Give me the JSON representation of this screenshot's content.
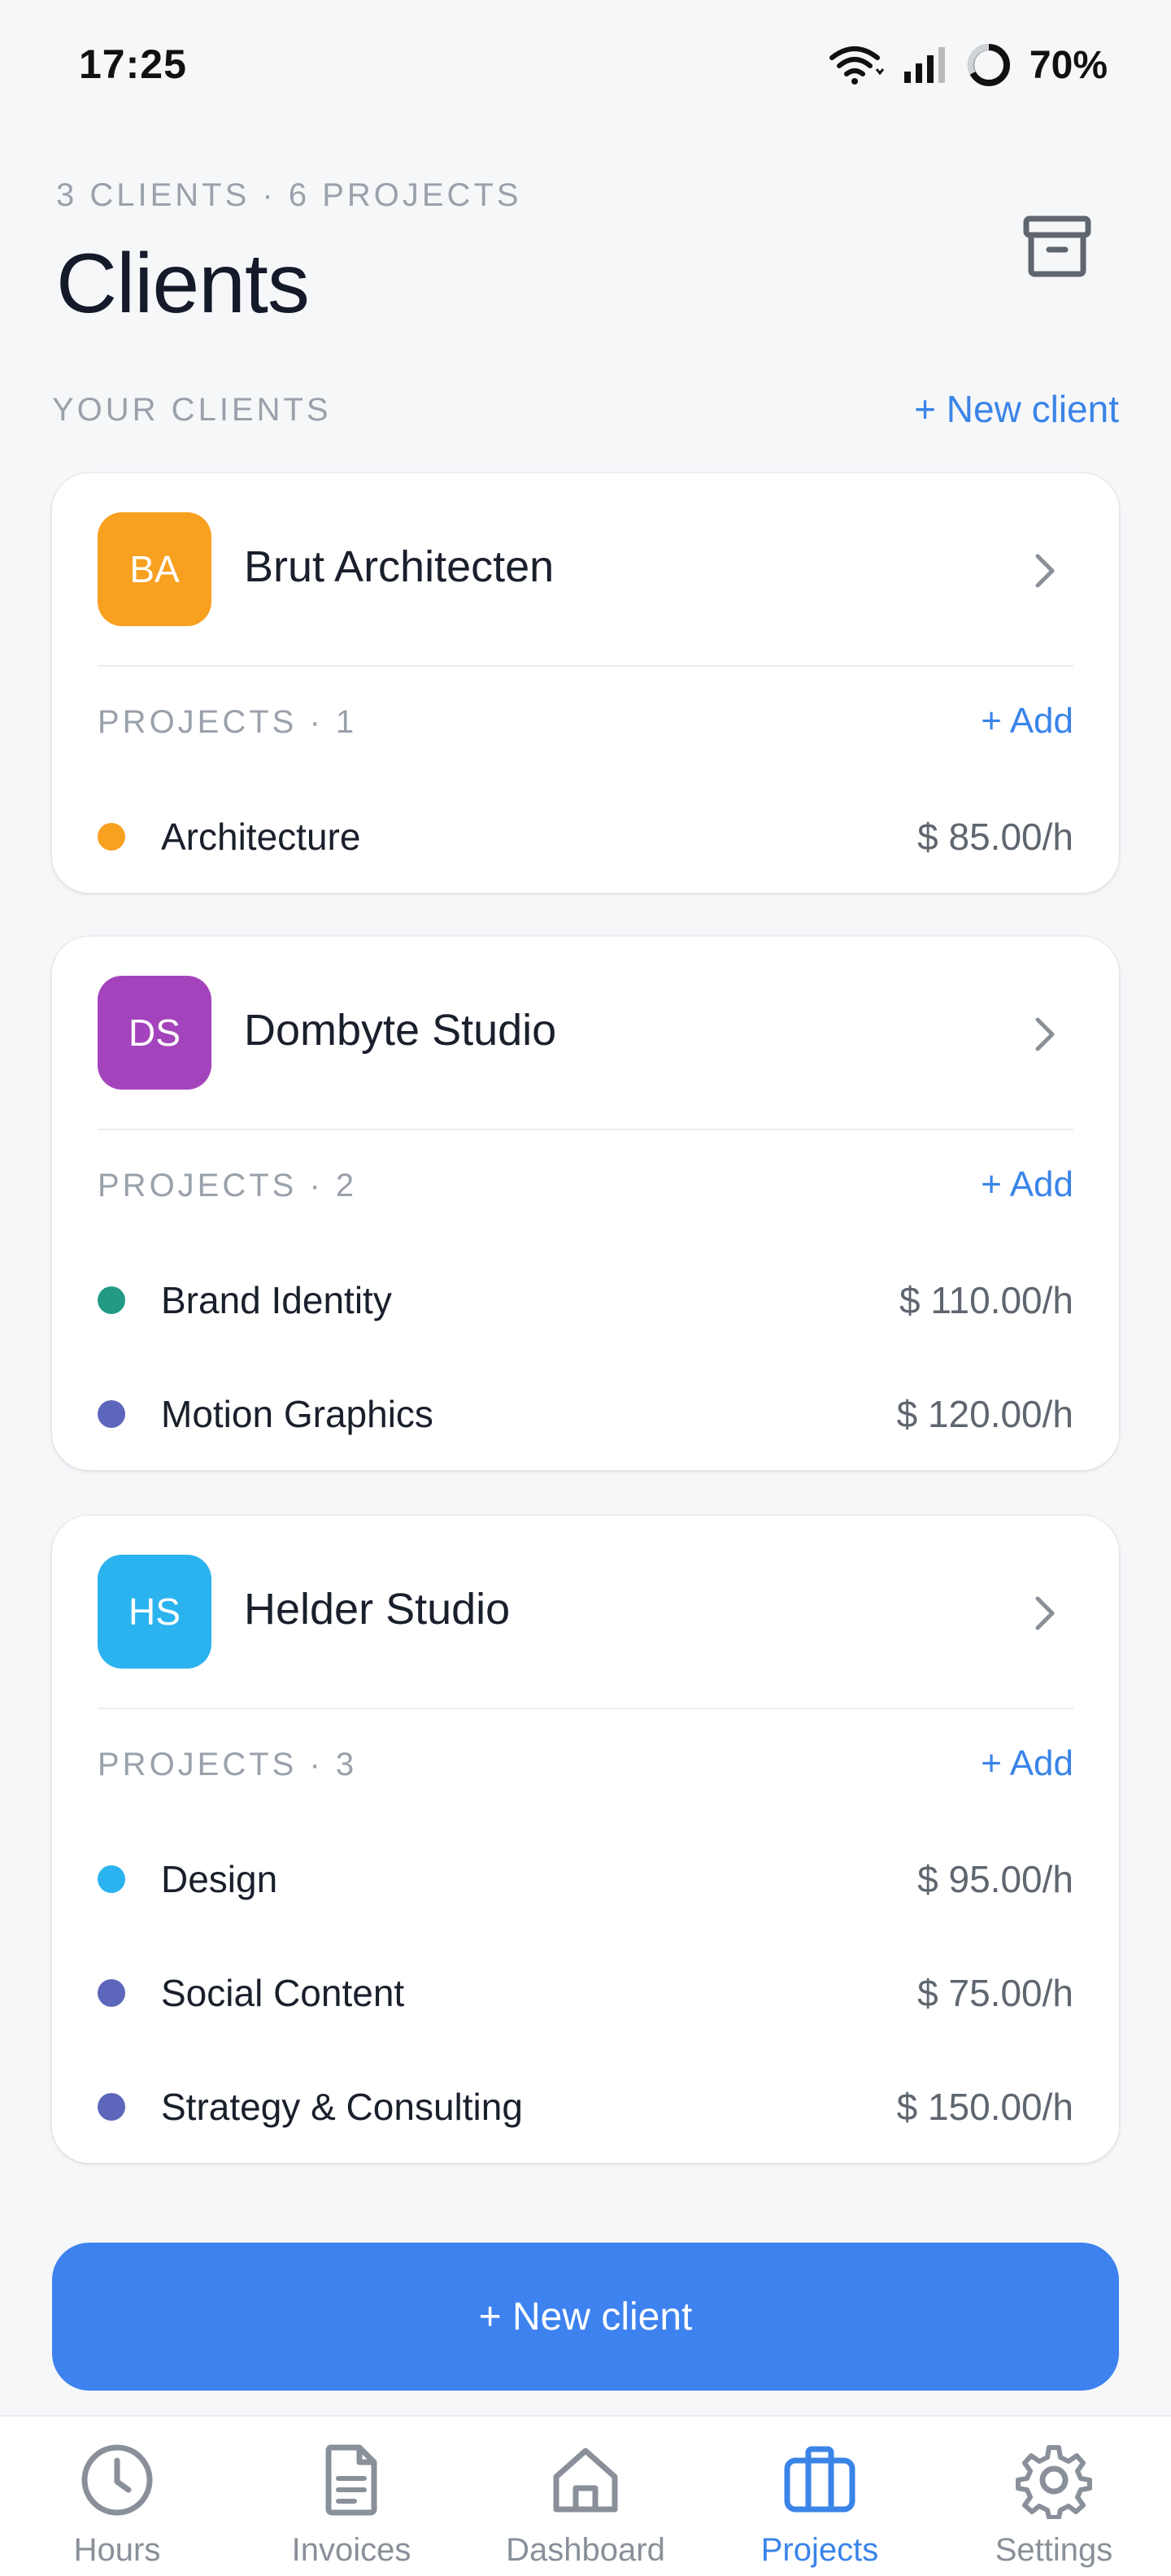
{
  "status": {
    "time": "17:25",
    "battery": "70%"
  },
  "header": {
    "meta": "3 CLIENTS · 6 PROJECTS",
    "title": "Clients",
    "section_label": "YOUR CLIENTS",
    "new_client_link": "+ New client"
  },
  "clients": [
    {
      "initials": "BA",
      "name": "Brut Architecten",
      "color": "#f8a020",
      "projects_label": "PROJECTS · 1",
      "add_label": "+ Add",
      "projects": [
        {
          "name": "Architecture",
          "rate": "$ 85.00/h",
          "color": "#f8a020"
        }
      ]
    },
    {
      "initials": "DS",
      "name": "Dombyte Studio",
      "color": "#a444bc",
      "projects_label": "PROJECTS · 2",
      "add_label": "+ Add",
      "projects": [
        {
          "name": "Brand Identity",
          "rate": "$ 110.00/h",
          "color": "#229a86"
        },
        {
          "name": "Motion Graphics",
          "rate": "$ 120.00/h",
          "color": "#5c66bb"
        }
      ]
    },
    {
      "initials": "HS",
      "name": "Helder Studio",
      "color": "#2bb3ef",
      "projects_label": "PROJECTS · 3",
      "add_label": "+ Add",
      "projects": [
        {
          "name": "Design",
          "rate": "$ 95.00/h",
          "color": "#2bb3ef"
        },
        {
          "name": "Social Content",
          "rate": "$ 75.00/h",
          "color": "#5c66bb"
        },
        {
          "name": "Strategy & Consulting",
          "rate": "$ 150.00/h",
          "color": "#5c66bb"
        }
      ]
    }
  ],
  "primary_button": "+ New client",
  "nav": [
    {
      "label": "Hours",
      "icon": "clock-icon",
      "active": false
    },
    {
      "label": "Invoices",
      "icon": "document-icon",
      "active": false
    },
    {
      "label": "Dashboard",
      "icon": "home-icon",
      "active": false
    },
    {
      "label": "Projects",
      "icon": "briefcase-icon",
      "active": true
    },
    {
      "label": "Settings",
      "icon": "gear-icon",
      "active": false
    }
  ],
  "colors": {
    "accent": "#3d82ef",
    "link": "#3a84e8",
    "muted": "#9aa1ab"
  }
}
